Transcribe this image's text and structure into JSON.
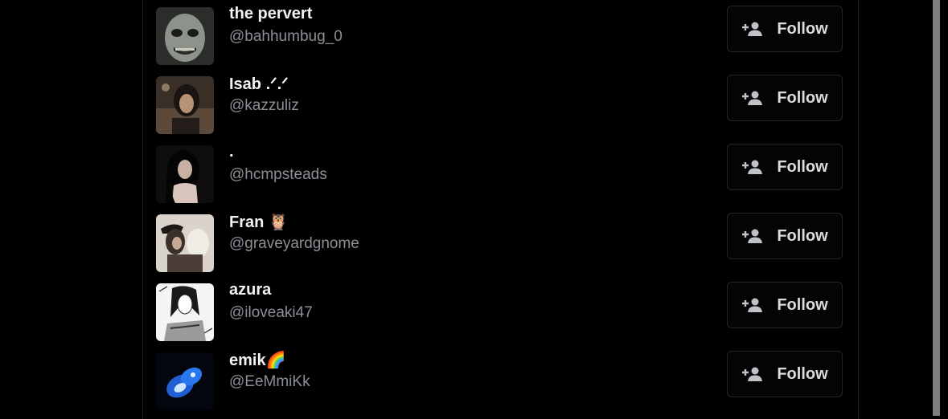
{
  "colors": {
    "background": "#000000",
    "name_text": "#f2f2f2",
    "handle_text": "#8b9096",
    "button_border": "#232427",
    "button_text": "#dcdcdc"
  },
  "follow_icon": "person-plus-icon",
  "users": [
    {
      "name": "the pervert",
      "handle": "@bahhumbug_0",
      "avatar": "pale-face-avatar",
      "button_label": "Follow"
    },
    {
      "name": "Isab .ᐟ.ᐟ",
      "handle": "@kazzuliz",
      "avatar": "girl-photo-avatar",
      "button_label": "Follow"
    },
    {
      "name": ".",
      "handle": "@hcmpsteads",
      "avatar": "dark-hair-girl-avatar",
      "button_label": "Follow"
    },
    {
      "name": "Fran 🦉",
      "handle": "@graveyardgnome",
      "avatar": "two-figures-avatar",
      "button_label": "Follow"
    },
    {
      "name": "azura",
      "handle": "@iloveaki47",
      "avatar": "manga-avatar",
      "button_label": "Follow"
    },
    {
      "name": "emik🌈",
      "handle": "@EeMmiKk",
      "avatar": "blue-butterfly-avatar",
      "button_label": "Follow"
    }
  ]
}
